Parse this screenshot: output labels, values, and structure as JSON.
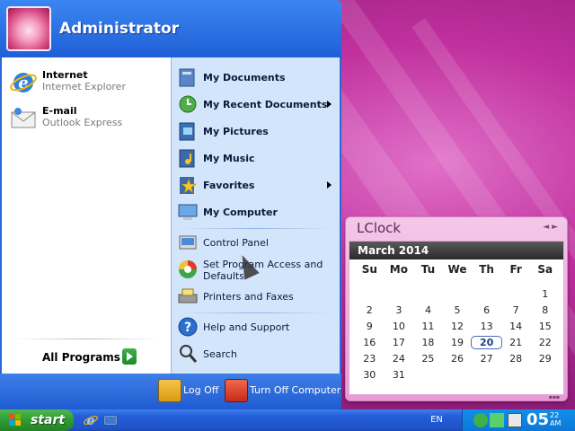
{
  "start_menu": {
    "user_name": "Administrator",
    "pinned": [
      {
        "title": "Internet",
        "subtitle": "Internet Explorer",
        "icon": "internet-explorer-icon"
      },
      {
        "title": "E-mail",
        "subtitle": "Outlook Express",
        "icon": "outlook-express-icon"
      }
    ],
    "all_programs_label": "All Programs",
    "places": [
      {
        "label": "My Documents",
        "icon": "documents-folder-icon"
      },
      {
        "label": "My Recent Documents",
        "icon": "recent-documents-icon",
        "has_submenu": true
      },
      {
        "label": "My Pictures",
        "icon": "pictures-folder-icon"
      },
      {
        "label": "My Music",
        "icon": "music-folder-icon"
      },
      {
        "label": "Favorites",
        "icon": "favorites-icon",
        "has_submenu": true
      },
      {
        "label": "My Computer",
        "icon": "computer-icon"
      }
    ],
    "system": [
      {
        "label": "Control Panel",
        "icon": "control-panel-icon"
      },
      {
        "label": "Set Program Access and Defaults",
        "icon": "program-access-icon"
      },
      {
        "label": "Printers and Faxes",
        "icon": "printer-icon"
      }
    ],
    "help": [
      {
        "label": "Help and Support",
        "icon": "help-icon"
      },
      {
        "label": "Search",
        "icon": "search-icon"
      }
    ],
    "log_off_label": "Log Off",
    "turn_off_label": "Turn Off Computer"
  },
  "taskbar": {
    "start_label": "start",
    "language": "EN",
    "clock_hour": "05",
    "clock_minute": "22",
    "clock_period": "AM"
  },
  "lclock": {
    "title": "LClock",
    "nav": "◄ ►",
    "month_label": "March 2014",
    "weekdays": [
      "Su",
      "Mo",
      "Tu",
      "We",
      "Th",
      "Fr",
      "Sa"
    ],
    "weeks": [
      [
        "",
        "",
        "",
        "",
        "",
        "",
        "1"
      ],
      [
        "2",
        "3",
        "4",
        "5",
        "6",
        "7",
        "8"
      ],
      [
        "9",
        "10",
        "11",
        "12",
        "13",
        "14",
        "15"
      ],
      [
        "16",
        "17",
        "18",
        "19",
        "20",
        "21",
        "22"
      ],
      [
        "23",
        "24",
        "25",
        "26",
        "27",
        "28",
        "29"
      ],
      [
        "30",
        "31",
        "",
        "",
        "",
        "",
        ""
      ]
    ],
    "today": "20"
  }
}
